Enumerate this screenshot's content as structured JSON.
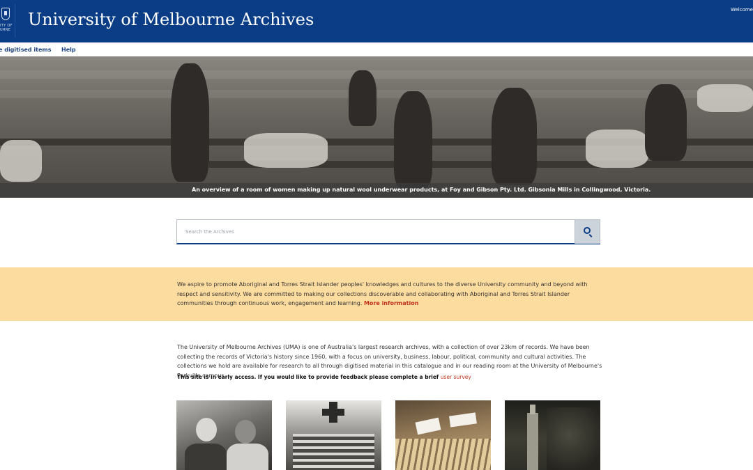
{
  "header": {
    "title": "University of Melbourne Archives",
    "logo_text_line1": "ITY OF",
    "logo_text_line2": "URNE",
    "welcome": "Welcome"
  },
  "nav": {
    "items": [
      {
        "label": "e digitised items"
      },
      {
        "label": "Help"
      }
    ]
  },
  "hero": {
    "caption": "An overview of a room of women making up natural wool underwear products, at Foy and Gibson Pty. Ltd. Gibsonia Mills in Collingwood, Victoria."
  },
  "search": {
    "placeholder": "Search the Archives",
    "icon": "search-icon"
  },
  "acknowledgement": {
    "text": "We aspire to promote Aboriginal and Torres Strait Islander peoples' knowledges and cultures to the diverse University community and beyond with respect and sensitivity. We are committed to making our collections discoverable and collaborating with Aboriginal and Torres Strait Islander communities through continuous work, engagement and learning.",
    "link": "More information",
    "background_color": "#fddca0",
    "link_color": "#c2331b"
  },
  "intro": {
    "text": "The University of Melbourne Archives (UMA) is one of Australia's largest research archives, with a collection of over 23km of records. We have been collecting the records of Victoria's history since 1960, with a focus on university, business, labour, political, community and cultural activities. The collections we hold are available for research to all through digitised material in this catalogue and in our reading room at the University of Melbourne's Parkville campus.",
    "early_access": "This site is in early access. If you would like to provide feedback please complete a brief",
    "survey_link": "user survey"
  },
  "colors": {
    "brand": "#0a3d85",
    "nav_text": "#1b3f7a"
  }
}
